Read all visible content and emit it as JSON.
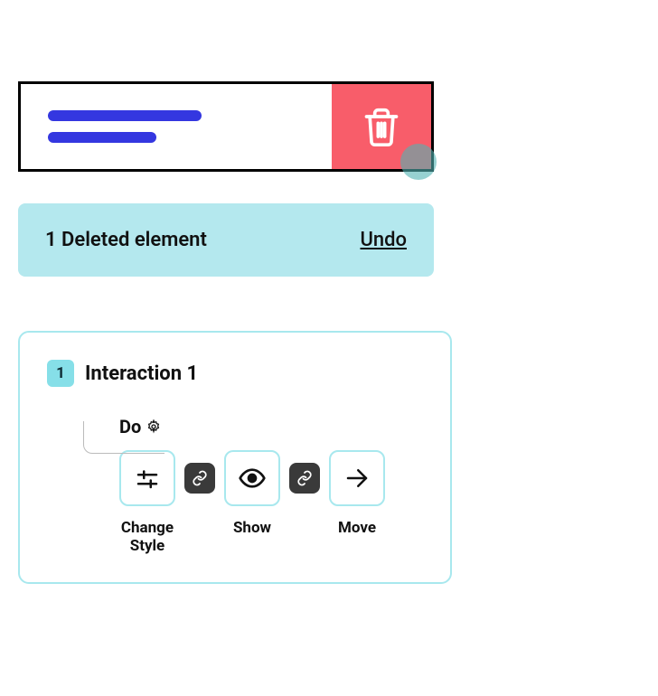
{
  "toast": {
    "message": "1 Deleted element",
    "action_label": "Undo"
  },
  "interaction": {
    "badge": "1",
    "title": "Interaction 1",
    "do_label": "Do",
    "actions": [
      {
        "label": "Change Style"
      },
      {
        "label": "Show"
      },
      {
        "label": "Move"
      }
    ]
  }
}
